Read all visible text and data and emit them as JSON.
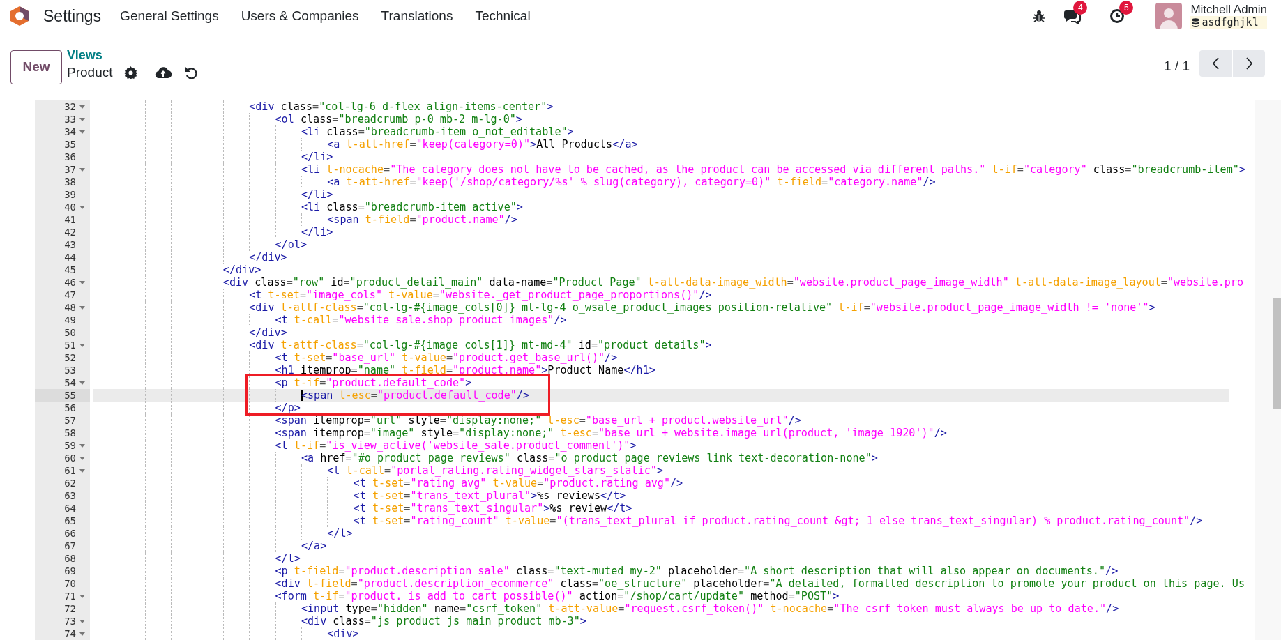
{
  "app": {
    "name": "Settings",
    "menu": [
      "General Settings",
      "Users & Companies",
      "Translations",
      "Technical"
    ],
    "messages_badge": "4",
    "activities_badge": "5",
    "user": {
      "name": "Mitchell Admin",
      "database": "asdfghjkl"
    }
  },
  "control_panel": {
    "new_button": "New",
    "breadcrumb": "Views",
    "record": "Product",
    "pager": "1 / 1"
  },
  "editor": {
    "lines": [
      {
        "number": "32",
        "foldable": true,
        "active": false,
        "text": "                        <div class=\"col-lg-6 d-flex align-items-center\">"
      },
      {
        "number": "33",
        "foldable": true,
        "active": false,
        "text": "                            <ol class=\"breadcrumb p-0 mb-2 m-lg-0\">"
      },
      {
        "number": "34",
        "foldable": true,
        "active": false,
        "text": "                                <li class=\"breadcrumb-item o_not_editable\">"
      },
      {
        "number": "35",
        "foldable": false,
        "active": false,
        "text": "                                    <a t-att-href=\"keep(category=0)\">All Products</a>"
      },
      {
        "number": "36",
        "foldable": false,
        "active": false,
        "text": "                                </li>"
      },
      {
        "number": "37",
        "foldable": true,
        "active": false,
        "text": "                                <li t-nocache=\"The category does not have to be cached, as the product can be accessed via different paths.\" t-if=\"category\" class=\"breadcrumb-item\">"
      },
      {
        "number": "38",
        "foldable": false,
        "active": false,
        "text": "                                    <a t-att-href=\"keep('/shop/category/%s' % slug(category), category=0)\" t-field=\"category.name\"/>"
      },
      {
        "number": "39",
        "foldable": false,
        "active": false,
        "text": "                                </li>"
      },
      {
        "number": "40",
        "foldable": true,
        "active": false,
        "text": "                                <li class=\"breadcrumb-item active\">"
      },
      {
        "number": "41",
        "foldable": false,
        "active": false,
        "text": "                                    <span t-field=\"product.name\"/>"
      },
      {
        "number": "42",
        "foldable": false,
        "active": false,
        "text": "                                </li>"
      },
      {
        "number": "43",
        "foldable": false,
        "active": false,
        "text": "                            </ol>"
      },
      {
        "number": "44",
        "foldable": false,
        "active": false,
        "text": "                        </div>"
      },
      {
        "number": "45",
        "foldable": false,
        "active": false,
        "text": "                    </div>"
      },
      {
        "number": "46",
        "foldable": true,
        "active": false,
        "text": "                    <div class=\"row\" id=\"product_detail_main\" data-name=\"Product Page\" t-att-data-image_width=\"website.product_page_image_width\" t-att-data-image_layout=\"website.pro"
      },
      {
        "number": "47",
        "foldable": false,
        "active": false,
        "text": "                        <t t-set=\"image_cols\" t-value=\"website._get_product_page_proportions()\"/>"
      },
      {
        "number": "48",
        "foldable": true,
        "active": false,
        "text": "                        <div t-attf-class=\"col-lg-#{image_cols[0]} mt-lg-4 o_wsale_product_images position-relative\" t-if=\"website.product_page_image_width != 'none'\">"
      },
      {
        "number": "49",
        "foldable": false,
        "active": false,
        "text": "                            <t t-call=\"website_sale.shop_product_images\"/>"
      },
      {
        "number": "50",
        "foldable": false,
        "active": false,
        "text": "                        </div>"
      },
      {
        "number": "51",
        "foldable": true,
        "active": false,
        "text": "                        <div t-attf-class=\"col-lg-#{image_cols[1]} mt-md-4\" id=\"product_details\">"
      },
      {
        "number": "52",
        "foldable": false,
        "active": false,
        "text": "                            <t t-set=\"base_url\" t-value=\"product.get_base_url()\"/>"
      },
      {
        "number": "53",
        "foldable": false,
        "active": false,
        "text": "                            <h1 itemprop=\"name\" t-field=\"product.name\">Product Name</h1>"
      },
      {
        "number": "54",
        "foldable": true,
        "active": false,
        "text": "                            <p t-if=\"product.default_code\">"
      },
      {
        "number": "55",
        "foldable": false,
        "active": true,
        "text": "                                <span t-esc=\"product.default_code\"/>"
      },
      {
        "number": "56",
        "foldable": false,
        "active": false,
        "text": "                            </p>"
      },
      {
        "number": "57",
        "foldable": false,
        "active": false,
        "text": "                            <span itemprop=\"url\" style=\"display:none;\" t-esc=\"base_url + product.website_url\"/>"
      },
      {
        "number": "58",
        "foldable": false,
        "active": false,
        "text": "                            <span itemprop=\"image\" style=\"display:none;\" t-esc=\"base_url + website.image_url(product, 'image_1920')\"/>"
      },
      {
        "number": "59",
        "foldable": true,
        "active": false,
        "text": "                            <t t-if=\"is_view_active('website_sale.product_comment')\">"
      },
      {
        "number": "60",
        "foldable": true,
        "active": false,
        "text": "                                <a href=\"#o_product_page_reviews\" class=\"o_product_page_reviews_link text-decoration-none\">"
      },
      {
        "number": "61",
        "foldable": true,
        "active": false,
        "text": "                                    <t t-call=\"portal_rating.rating_widget_stars_static\">"
      },
      {
        "number": "62",
        "foldable": false,
        "active": false,
        "text": "                                        <t t-set=\"rating_avg\" t-value=\"product.rating_avg\"/>"
      },
      {
        "number": "63",
        "foldable": false,
        "active": false,
        "text": "                                        <t t-set=\"trans_text_plural\">%s reviews</t>"
      },
      {
        "number": "64",
        "foldable": false,
        "active": false,
        "text": "                                        <t t-set=\"trans_text_singular\">%s review</t>"
      },
      {
        "number": "65",
        "foldable": false,
        "active": false,
        "text": "                                        <t t-set=\"rating_count\" t-value=\"(trans_text_plural if product.rating_count &gt; 1 else trans_text_singular) % product.rating_count\"/>"
      },
      {
        "number": "66",
        "foldable": false,
        "active": false,
        "text": "                                    </t>"
      },
      {
        "number": "67",
        "foldable": false,
        "active": false,
        "text": "                                </a>"
      },
      {
        "number": "68",
        "foldable": false,
        "active": false,
        "text": "                            </t>"
      },
      {
        "number": "69",
        "foldable": false,
        "active": false,
        "text": "                            <p t-field=\"product.description_sale\" class=\"text-muted my-2\" placeholder=\"A short description that will also appear on documents.\"/>"
      },
      {
        "number": "70",
        "foldable": false,
        "active": false,
        "text": "                            <div t-field=\"product.description_ecommerce\" class=\"oe_structure\" placeholder=\"A detailed, formatted description to promote your product on this page. Us"
      },
      {
        "number": "71",
        "foldable": true,
        "active": false,
        "text": "                            <form t-if=\"product._is_add_to_cart_possible()\" action=\"/shop/cart/update\" method=\"POST\">"
      },
      {
        "number": "72",
        "foldable": false,
        "active": false,
        "text": "                                <input type=\"hidden\" name=\"csrf_token\" t-att-value=\"request.csrf_token()\" t-nocache=\"The csrf token must always be up to date.\"/>"
      },
      {
        "number": "73",
        "foldable": true,
        "active": false,
        "text": "                                <div class=\"js_product js_main_product mb-3\">"
      },
      {
        "number": "74",
        "foldable": true,
        "active": false,
        "text": "                                    <div>"
      }
    ]
  }
}
